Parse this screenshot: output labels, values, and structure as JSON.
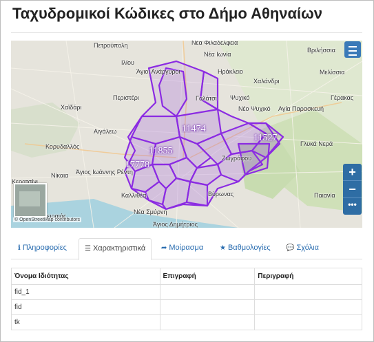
{
  "title": "Ταχυδρομικοί Κώδικες στο Δήμο Αθηναίων",
  "map": {
    "places": [
      "Πετρούπολη",
      "Νέα Φιλαδέλφεια",
      "Βριλήσσια",
      "Νέα Ιωνία",
      "Ιλίου",
      "Άγιοι Ανάργυροι",
      "Ηράκλειο",
      "Μελίσσια",
      "Χαλάνδρι",
      "Περιστέρι",
      "Γαλάτσι",
      "Ψυχικό",
      "Χαϊδάρι",
      "Νέο Ψυχικό",
      "Αγία Παρασκευή",
      "Γέρακας",
      "Αιγάλεω",
      "Κορυδαλλός",
      "Άγιος Ιωάννης Ρέντη",
      "Νίκαια",
      "Ζωγράφου",
      "Βύρωνας",
      "Κερατσίνι",
      "Καλλιθέα",
      "Νέα Σμύρνη",
      "Γλυκά Νερά",
      "Παιανία",
      "Άγιος Δημήτριος",
      "Πειραιάς"
    ],
    "labels": [
      "11474",
      "11855",
      "11527",
      "17778"
    ],
    "layers_icon": "menu-icon",
    "zoom_in": "+",
    "zoom_out": "−",
    "more": "•••",
    "attribution": "© OpenStreetMap contributors",
    "polygon_color": "#8b2be2"
  },
  "tabs": [
    {
      "icon": "ℹ",
      "label": "Πληροφορίες"
    },
    {
      "icon": "☰",
      "label": "Χαρακτηριστικά",
      "active": true
    },
    {
      "icon": "➦",
      "label": "Μοίρασμα"
    },
    {
      "icon": "★",
      "label": "Βαθμολογίες"
    },
    {
      "icon": "💬",
      "label": "Σχόλια"
    }
  ],
  "table": {
    "headers": [
      "Όνομα Ιδιότητας",
      "Επιγραφή",
      "Περιγραφή"
    ],
    "rows": [
      [
        "fid_1",
        "",
        ""
      ],
      [
        "fid",
        "",
        ""
      ],
      [
        "tk",
        "",
        ""
      ]
    ]
  }
}
